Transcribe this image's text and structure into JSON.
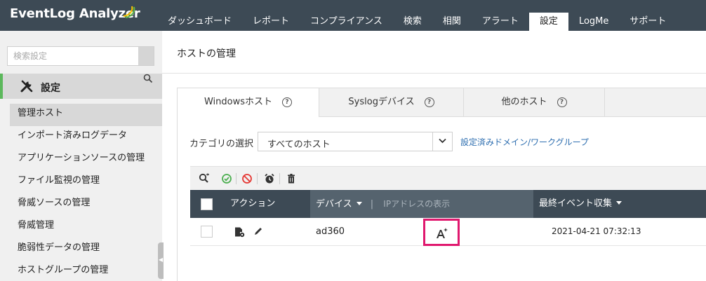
{
  "app": {
    "logo_text": "EventLog Analyzer"
  },
  "nav": {
    "items": [
      {
        "label": "ダッシュボード"
      },
      {
        "label": "レポート"
      },
      {
        "label": "コンプライアンス"
      },
      {
        "label": "検索"
      },
      {
        "label": "相関"
      },
      {
        "label": "アラート"
      },
      {
        "label": "設定"
      },
      {
        "label": "LogMe"
      },
      {
        "label": "サポート"
      }
    ],
    "active": "設定"
  },
  "sidebar": {
    "search_placeholder": "検索設定",
    "section_label": "設定",
    "items": [
      {
        "label": "管理ホスト"
      },
      {
        "label": "インポート済みログデータ"
      },
      {
        "label": "アプリケーションソースの管理"
      },
      {
        "label": "ファイル監視の管理"
      },
      {
        "label": "脅威ソースの管理"
      },
      {
        "label": "脅威管理"
      },
      {
        "label": "脆弱性データの管理"
      },
      {
        "label": "ホストグループの管理"
      }
    ]
  },
  "main": {
    "page_title": "ホストの管理",
    "tabs": [
      {
        "label": "Windowsホスト",
        "help": "?"
      },
      {
        "label": "Syslogデバイス",
        "help": "?"
      },
      {
        "label": "他のホスト",
        "help": "?"
      }
    ],
    "category_label": "カテゴリの選択",
    "category_value": "すべてのホスト",
    "domain_link": "設定済みドメイン/ワークグループ",
    "table": {
      "headers": {
        "action": "アクション",
        "device": "デバイス",
        "ip_toggle": "IPアドレスの表示",
        "last_event": "最終イベント収集"
      },
      "rows": [
        {
          "device": "ad360",
          "last_event": "2021-04-21 07:32:13"
        }
      ]
    }
  },
  "colors": {
    "topbar": "#3d4a55",
    "accent_green": "#5cb85c",
    "highlight": "#e0186e",
    "link": "#2f6fb0"
  },
  "icons": {
    "toolbar": [
      "search-filter-icon",
      "enable-icon",
      "disable-icon",
      "alarm-icon",
      "trash-icon"
    ],
    "row_actions": [
      "config-icon",
      "edit-icon"
    ],
    "highlight_icon": "font-sparkle-icon"
  }
}
